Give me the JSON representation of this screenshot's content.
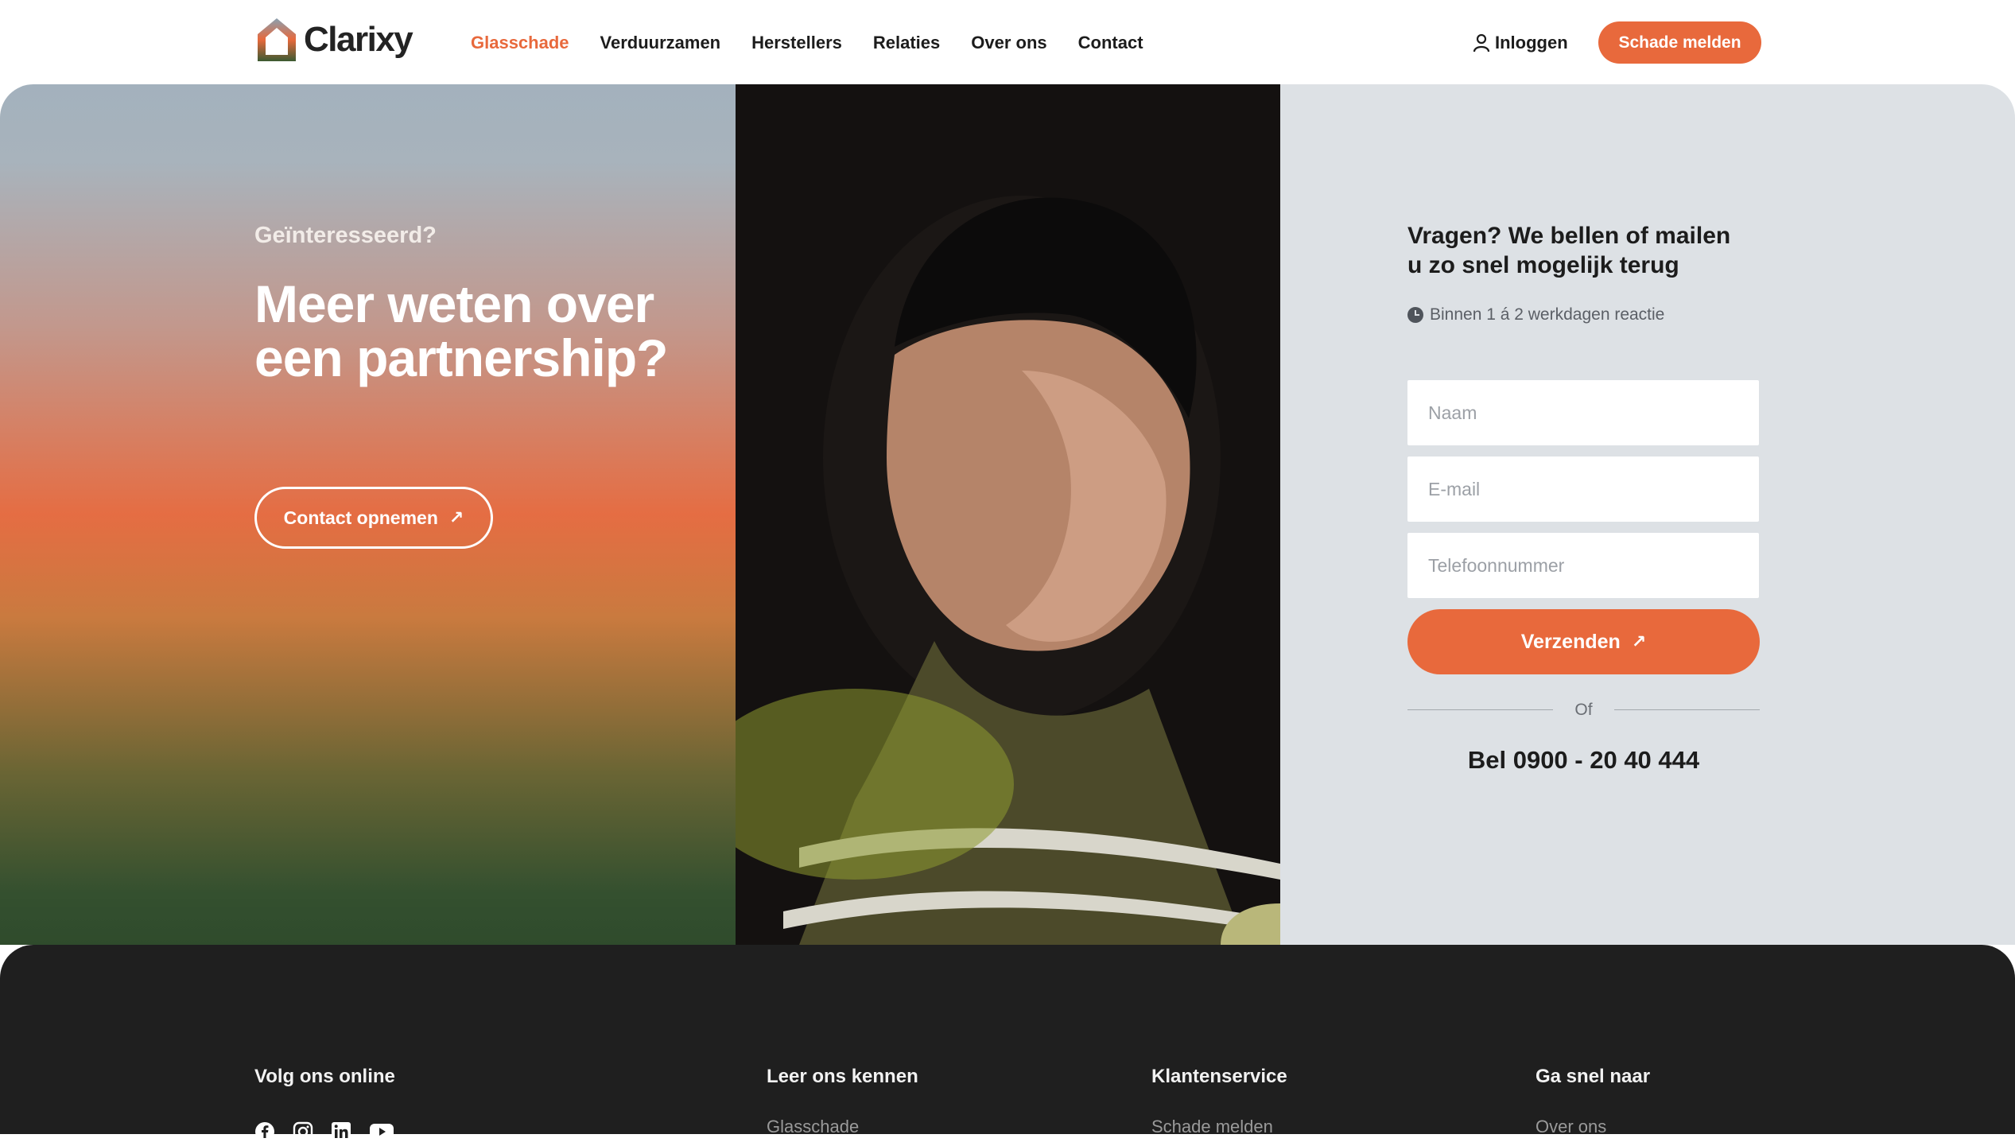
{
  "brand": {
    "name": "Clarixy",
    "accent": "#e8693c"
  },
  "nav": {
    "items": [
      {
        "label": "Glasschade",
        "active": true
      },
      {
        "label": "Verduurzamen"
      },
      {
        "label": "Herstellers"
      },
      {
        "label": "Relaties"
      },
      {
        "label": "Over ons"
      },
      {
        "label": "Contact"
      }
    ],
    "login_label": "Inloggen",
    "report_button": "Schade melden"
  },
  "hero": {
    "eyebrow": "Geïnteresseerd?",
    "title": "Meer weten over een partnership?",
    "cta": "Contact opnemen"
  },
  "form": {
    "title": "Vragen? We bellen of mailen u zo snel mogelijk terug",
    "reply_note": "Binnen 1 á 2 werkdagen reactie",
    "fields": {
      "name_placeholder": "Naam",
      "email_placeholder": "E-mail",
      "phone_placeholder": "Telefoonnummer"
    },
    "submit": "Verzenden",
    "or": "Of",
    "phone_cta": "Bel 0900 - 20 40 444"
  },
  "footer": {
    "follow": "Volg ons online",
    "columns": [
      {
        "title": "Leer ons kennen",
        "first_link": "Glasschade"
      },
      {
        "title": "Klantenservice",
        "first_link": "Schade melden"
      },
      {
        "title": "Ga snel naar",
        "first_link": "Over ons"
      }
    ],
    "social_icons": [
      "facebook-icon",
      "instagram-icon",
      "linkedin-icon",
      "youtube-icon"
    ]
  }
}
